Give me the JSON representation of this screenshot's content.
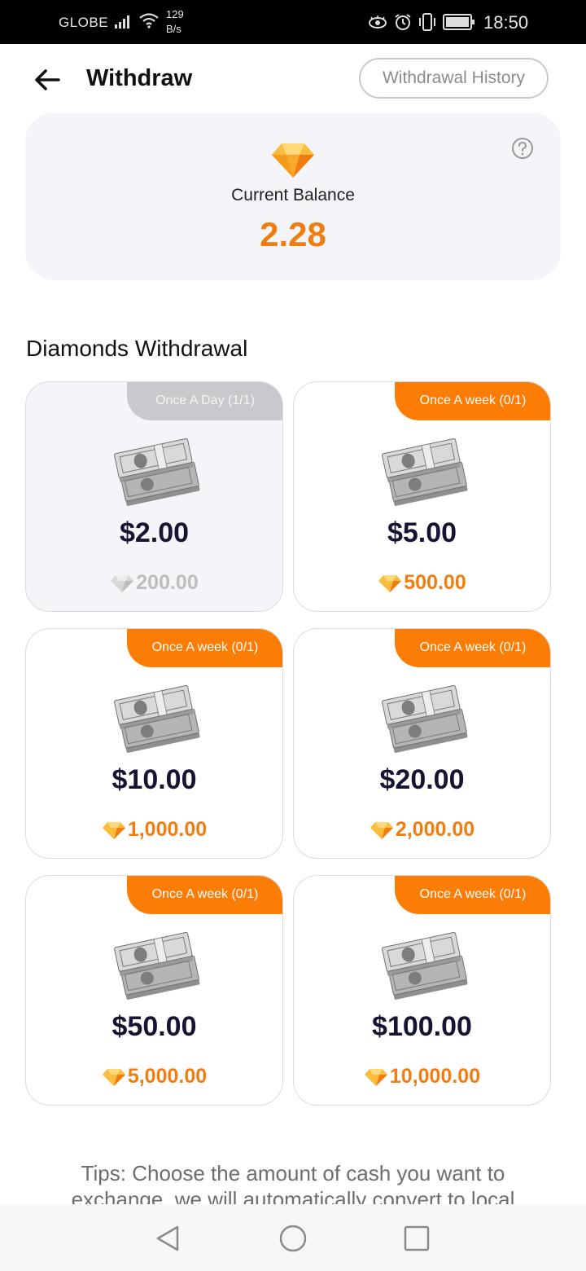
{
  "status_bar": {
    "carrier": "GLOBE",
    "net_speed_value": "129",
    "net_speed_unit": "B/s",
    "time": "18:50"
  },
  "header": {
    "title": "Withdraw",
    "history_label": "Withdrawal History"
  },
  "balance": {
    "label": "Current Balance",
    "value": "2.28"
  },
  "section_title": "Diamonds Withdrawal",
  "options": [
    {
      "tag": "Once A Day (1/1)",
      "amount": "$2.00",
      "cost": "200.00",
      "used": true
    },
    {
      "tag": "Once A week (0/1)",
      "amount": "$5.00",
      "cost": "500.00",
      "used": false
    },
    {
      "tag": "Once A week (0/1)",
      "amount": "$10.00",
      "cost": "1,000.00",
      "used": false
    },
    {
      "tag": "Once A week (0/1)",
      "amount": "$20.00",
      "cost": "2,000.00",
      "used": false
    },
    {
      "tag": "Once A week (0/1)",
      "amount": "$50.00",
      "cost": "5,000.00",
      "used": false
    },
    {
      "tag": "Once A week (0/1)",
      "amount": "$100.00",
      "cost": "10,000.00",
      "used": false
    }
  ],
  "tips": "Tips: Choose the amount of cash you want to exchange, we will automatically convert to local",
  "colors": {
    "accent": "#fc7d06",
    "balance_text": "#f07d12",
    "amount_text": "#151433",
    "used_tag": "#c8c9cc",
    "card_bg_used": "#f4f5f9"
  },
  "icons": {
    "back": "arrow-left-icon",
    "help": "question-circle-icon",
    "diamond": "diamond-icon",
    "money": "cash-stack-icon",
    "nav_back": "triangle-back-icon",
    "nav_home": "circle-home-icon",
    "nav_recent": "square-recent-icon"
  }
}
